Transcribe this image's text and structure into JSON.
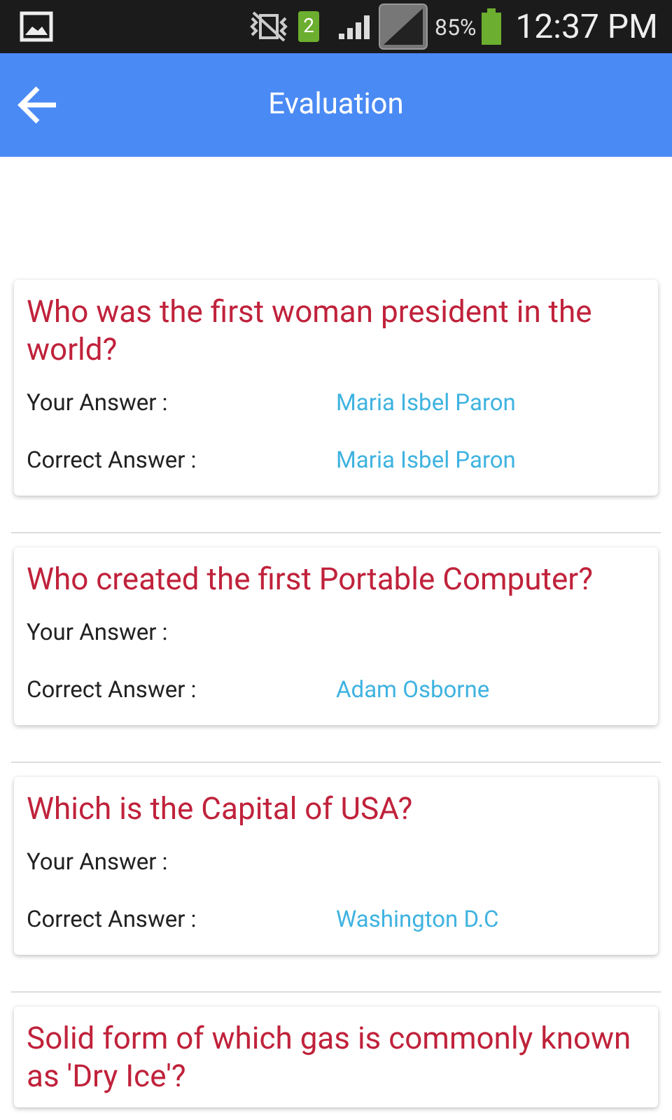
{
  "status_bar": {
    "sim_badge": "2",
    "battery": "85%",
    "time": "12:37 PM"
  },
  "app_bar": {
    "title": "Evaluation"
  },
  "questions": [
    {
      "question": "Who was the first woman president in the world?",
      "your_label": "Your Answer :",
      "your_answer": "Maria Isbel Paron",
      "correct_label": "Correct Answer :",
      "correct_answer": "Maria Isbel Paron"
    },
    {
      "question": "Who created the first Portable Computer?",
      "your_label": "Your Answer :",
      "correct_label": "Correct Answer :",
      "correct_answer": "Adam Osborne"
    },
    {
      "question": "Which is the Capital of USA?",
      "your_label": "Your Answer :",
      "correct_label": "Correct Answer :",
      "correct_answer": "Washington D.C"
    },
    {
      "question": "Solid form of which gas is commonly known as 'Dry Ice'?"
    }
  ]
}
